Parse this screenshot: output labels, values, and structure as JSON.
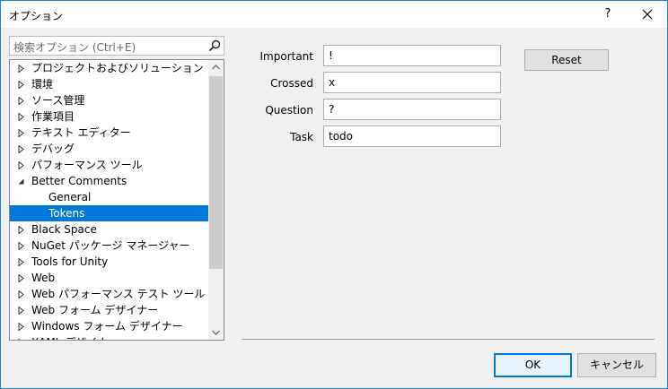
{
  "window": {
    "title": "オプション",
    "help_label": "?"
  },
  "search": {
    "placeholder": "検索オプション (Ctrl+E)"
  },
  "tree": {
    "items": [
      {
        "label": "プロジェクトおよびソリューション",
        "state": "collapsed"
      },
      {
        "label": "環境",
        "state": "collapsed"
      },
      {
        "label": "ソース管理",
        "state": "collapsed"
      },
      {
        "label": "作業項目",
        "state": "collapsed"
      },
      {
        "label": "テキスト エディター",
        "state": "collapsed"
      },
      {
        "label": "デバッグ",
        "state": "collapsed"
      },
      {
        "label": "パフォーマンス ツール",
        "state": "collapsed"
      },
      {
        "label": "Better Comments",
        "state": "expanded"
      },
      {
        "label": "General",
        "state": "child"
      },
      {
        "label": "Tokens",
        "state": "child-selected"
      },
      {
        "label": "Black Space",
        "state": "collapsed"
      },
      {
        "label": "NuGet パッケージ マネージャー",
        "state": "collapsed"
      },
      {
        "label": "Tools for Unity",
        "state": "collapsed"
      },
      {
        "label": "Web",
        "state": "collapsed"
      },
      {
        "label": "Web パフォーマンス テスト ツール",
        "state": "collapsed"
      },
      {
        "label": "Web フォーム デザイナー",
        "state": "collapsed"
      },
      {
        "label": "Windows フォーム デザイナー",
        "state": "collapsed"
      },
      {
        "label": "XAML デザイナー",
        "state": "collapsed"
      }
    ]
  },
  "fields": [
    {
      "label": "Important",
      "value": "!"
    },
    {
      "label": "Crossed",
      "value": "x"
    },
    {
      "label": "Question",
      "value": "?"
    },
    {
      "label": "Task",
      "value": "todo"
    }
  ],
  "buttons": {
    "reset": "Reset",
    "ok": "OK",
    "cancel": "キャンセル"
  },
  "colors": {
    "accent": "#0078d7",
    "border": "#1883d7"
  },
  "icons": {
    "search": "search-icon",
    "close": "close-icon",
    "collapsed": "triangle-right-icon",
    "expanded": "triangle-down-icon"
  }
}
